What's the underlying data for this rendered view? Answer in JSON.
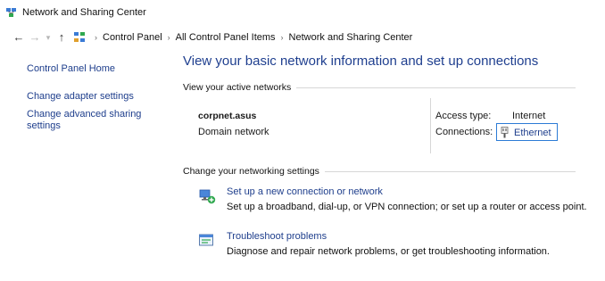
{
  "window": {
    "title": "Network and Sharing Center"
  },
  "address_bar": {
    "back_icon": "arrow-left-icon",
    "forward_icon": "arrow-right-icon",
    "recent_icon": "chevron-down-icon",
    "up_icon": "arrow-up-icon",
    "breadcrumbs": [
      "Control Panel",
      "All Control Panel Items",
      "Network and Sharing Center"
    ]
  },
  "sidebar": {
    "home": "Control Panel Home",
    "links": [
      "Change adapter settings",
      "Change advanced sharing settings"
    ]
  },
  "main": {
    "title": "View your basic network information and set up connections",
    "active_networks": {
      "header": "View your active networks",
      "network_name": "corpnet.asus",
      "network_type": "Domain network",
      "access_type_label": "Access type:",
      "access_type_value": "Internet",
      "connections_label": "Connections:",
      "connection_name": "Ethernet"
    },
    "change_settings": {
      "header": "Change your networking settings",
      "tasks": [
        {
          "link": "Set up a new connection or network",
          "description": "Set up a broadband, dial-up, or VPN connection; or set up a router or access point.",
          "icon": "new-connection-icon"
        },
        {
          "link": "Troubleshoot problems",
          "description": "Diagnose and repair network problems, or get troubleshooting information.",
          "icon": "troubleshoot-icon"
        }
      ]
    }
  },
  "colors": {
    "link": "#1e3e8c",
    "title": "#1f3f8f",
    "focus_border": "#2c7bd6"
  }
}
